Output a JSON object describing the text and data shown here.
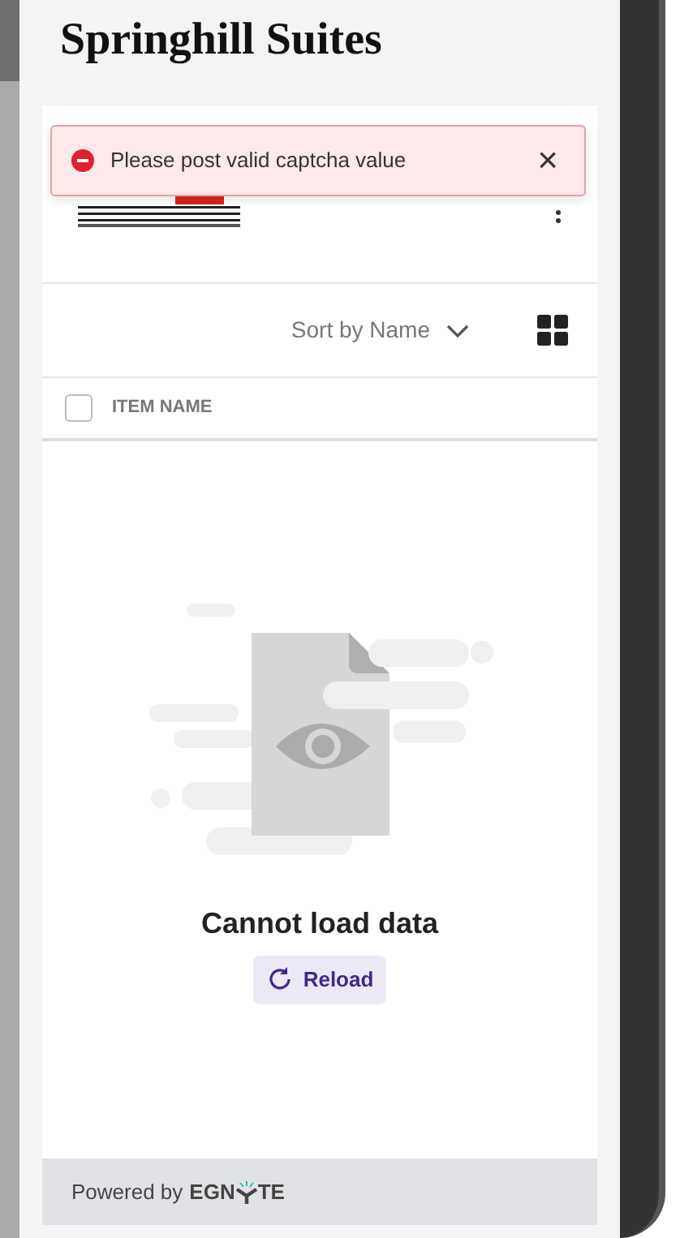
{
  "title": "Springhill Suites",
  "toast": {
    "kind": "error",
    "message": "Please post valid captcha value",
    "close": "×"
  },
  "toolbar": {
    "sort_label": "Sort by Name"
  },
  "table": {
    "columns": [
      {
        "label": "ITEM NAME",
        "checked": false
      }
    ]
  },
  "empty_state": {
    "message": "Cannot load data",
    "button": "Reload"
  },
  "footer": {
    "text": "Powered by",
    "brand_left": "EGN",
    "brand_right": "TE"
  }
}
